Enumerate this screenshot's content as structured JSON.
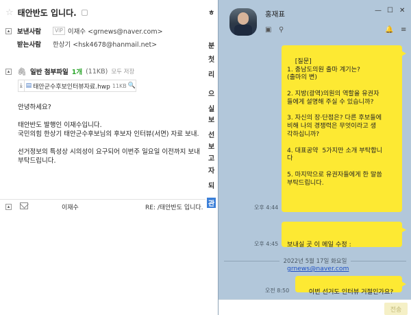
{
  "email": {
    "subject": "태안반도 입니다.",
    "sender_label": "보낸사람",
    "vip_badge": "VIP",
    "sender_value": "이재수 <grnews@naver.com>",
    "recipient_label": "받는사람",
    "recipient_value": "한상기 <hsk4678@hanmail.net>",
    "toggle_symbol": "▴",
    "attachments_label": "일반 첨부파일",
    "attachments_count": "1개",
    "attachments_size": "(11KB)",
    "save_all": "모두 저장",
    "file_name": "태안군수후보인터뷰자료.hwp",
    "file_size": "11KB",
    "body_lines": [
      "안녕하세요?",
      "태안반도 발행인 이재수입니다.",
      "국민의힘 한상기 태안군수후보님의 후보자 인터뷰(서면) 자료 보내.",
      "선거정보의 특성상 시의성이 요구되어 이번주 일요일 이전까지 보내",
      "부탁드립니다."
    ],
    "footer_sender": "이재수",
    "footer_subject": "RE: /태안반도 입니다."
  },
  "background": {
    "strip_chars": [
      "ㅎ",
      "분",
      "첫",
      "리",
      "으",
      "실",
      "보",
      "선",
      "보",
      "고",
      "자",
      "되",
      "관"
    ]
  },
  "chat": {
    "contact_name": "홍재표",
    "date_separator": "2022년 5월 17일 화요일",
    "messages": [
      {
        "text": "[질문]\n1. 충남도의원 출마 계기는?\n(출마의 변)\n\n2. 지방(광역)의원의 역할을 유권자\n들에게 설명해 주실 수 있습니까?\n\n3. 자신의 장·단점은? 다른 후보들에\n비해 나의 경쟁력은 무엇이라고 생\n각하십니까?\n\n4. 대표공약  5가지만 소개 부탁합니\n다\n\n5. 마지막으로 유권자들에게 한 말씀\n부탁드립니다.",
        "time": "오후 4:44"
      },
      {
        "text": "보내실 곳 이 메일 수정 :",
        "link": "grnews@naver.com",
        "time": "오후 4:45"
      },
      {
        "text": "이번 선거도 인터뷰 거절인가요?",
        "time": "오전 8:50"
      }
    ],
    "send_label": "전송"
  }
}
